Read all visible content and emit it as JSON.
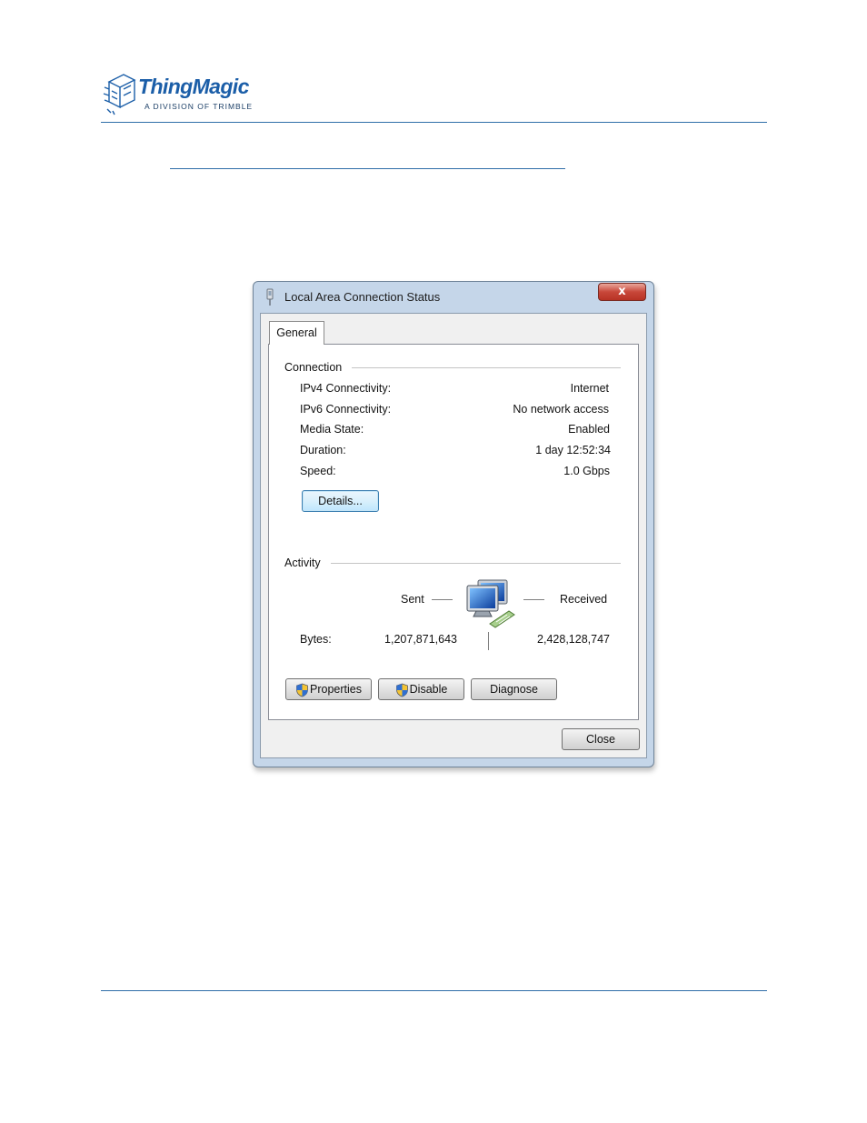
{
  "document": {
    "brand_name": "ThingMagic",
    "brand_tagline": "A DIVISION OF TRIMBLE",
    "brand_color": "#1b5ea8",
    "rule_color": "#2f6ea8"
  },
  "window": {
    "title": "Local Area Connection Status",
    "title_icon": "network-adapter-icon",
    "close_glyph": "x",
    "close_icon": "close-icon"
  },
  "tabs": [
    {
      "label": "General",
      "selected": true
    }
  ],
  "connection": {
    "section_label": "Connection",
    "rows": [
      {
        "label": "IPv4 Connectivity:",
        "value": "Internet"
      },
      {
        "label": "IPv6 Connectivity:",
        "value": "No network access"
      },
      {
        "label": "Media State:",
        "value": "Enabled"
      },
      {
        "label": "Duration:",
        "value": "1 day 12:52:34"
      },
      {
        "label": "Speed:",
        "value": "1.0 Gbps"
      }
    ],
    "details_button": "Details..."
  },
  "activity": {
    "section_label": "Activity",
    "sent_label": "Sent",
    "received_label": "Received",
    "bytes_label": "Bytes:",
    "bytes_sent": "1,207,871,643",
    "bytes_received": "2,428,128,747",
    "icon": "network-computers-icon"
  },
  "actions": {
    "properties": "Properties",
    "disable": "Disable",
    "diagnose": "Diagnose",
    "close": "Close",
    "shield_icon": "uac-shield-icon"
  }
}
